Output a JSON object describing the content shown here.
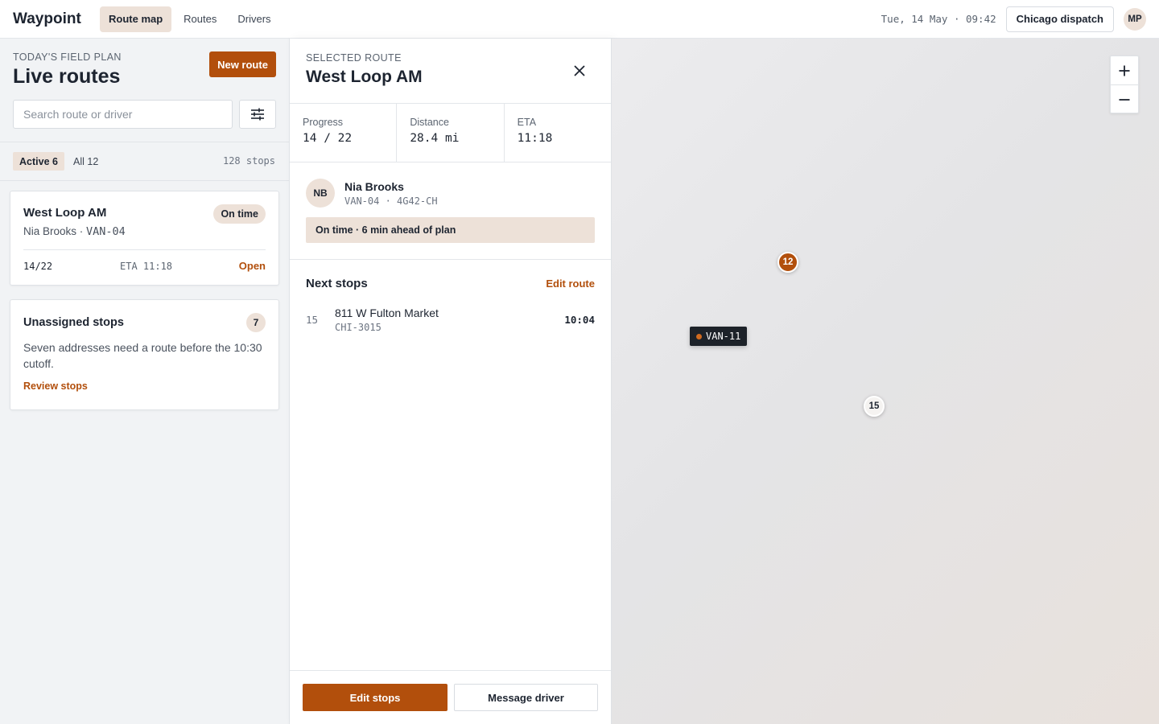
{
  "app": {
    "brand": "Waypoint",
    "nav": [
      "Route map",
      "Routes",
      "Drivers"
    ],
    "clock": "Tue, 14 May · 09:42",
    "dispatch": "Chicago dispatch",
    "user_initials": "MP"
  },
  "sidebar": {
    "eyebrow": "TODAY'S FIELD PLAN",
    "title": "Live routes",
    "new_route": "New route",
    "search_placeholder": "Search route or driver",
    "filters": {
      "active": "Active 6",
      "all": "All 12",
      "stops": "128 stops"
    },
    "route_card": {
      "title": "West Loop AM",
      "driver": "Nia Brooks · ",
      "vehicle": "VAN-04",
      "status": "On time",
      "progress": "14/22",
      "eta": "ETA 11:18",
      "action": "Open"
    },
    "unassigned_card": {
      "title": "Unassigned stops",
      "count": "7",
      "body": "Seven addresses need a route before the 10:30 cutoff.",
      "link": "Review stops"
    }
  },
  "detail": {
    "eyebrow": "SELECTED ROUTE",
    "title": "West Loop AM",
    "stats": [
      {
        "label": "Progress",
        "value": "14 / 22"
      },
      {
        "label": "Distance",
        "value": "28.4 mi"
      },
      {
        "label": "ETA",
        "value": "11:18"
      }
    ],
    "driver": {
      "initials": "NB",
      "name": "Nia Brooks",
      "meta": "VAN-04 · 4G42-CH",
      "status": "On time · 6 min ahead of plan"
    },
    "next_stops_title": "Next stops",
    "edit_route": "Edit route",
    "stops": [
      {
        "num": "15",
        "address": "811 W Fulton Market",
        "code": "CHI-3015",
        "time": "10:04"
      }
    ],
    "edit_stops": "Edit stops",
    "message_driver": "Message driver"
  },
  "map": {
    "pin_a": "12",
    "pin_b": "15",
    "vehicle_tag": "VAN-11",
    "accent": "#b24f0c"
  }
}
